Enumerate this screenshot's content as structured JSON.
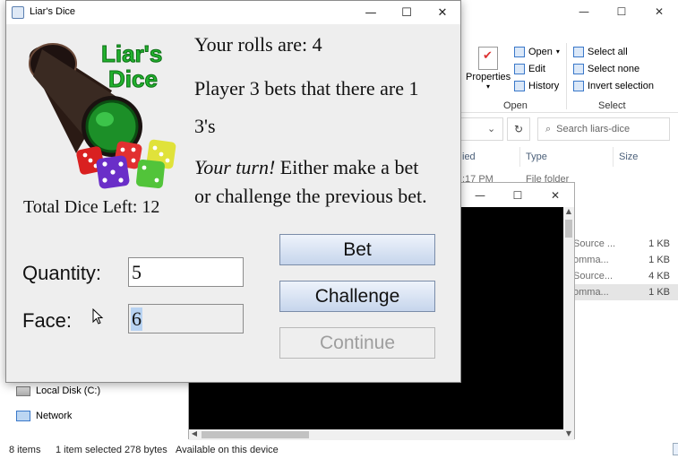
{
  "explorer": {
    "ribbon": {
      "properties_label": "Properties",
      "open_label": "Open",
      "edit_label": "Edit",
      "history_label": "History",
      "open_group": "Open",
      "select_all": "Select all",
      "select_none": "Select none",
      "invert_selection": "Invert selection",
      "select_group": "Select"
    },
    "search_placeholder": "Search liars-dice",
    "columns": {
      "date_fragment": "ied",
      "type": "Type",
      "size": "Size"
    },
    "folder_row": {
      "date_fragment": ":17 PM",
      "type": "File folder"
    },
    "files": [
      {
        "name": "Source ...",
        "size": "1 KB"
      },
      {
        "name": "omma...",
        "size": "1 KB"
      },
      {
        "name": "Source...",
        "size": "4 KB"
      },
      {
        "name": "omma...",
        "size": "1 KB"
      }
    ],
    "nav": {
      "local_disk": "Local Disk (C:)",
      "network": "Network"
    },
    "status": {
      "items": "8 items",
      "selected": "1 item selected  278 bytes",
      "availability": "Available on this device"
    }
  },
  "dice_window": {
    "title": "Liar's Dice",
    "logo_line1": "Liar's",
    "logo_line2": "Dice",
    "rolls_text": "Your rolls are: 4",
    "bet_line1": "Player 3 bets that there are 1",
    "bet_line2": "3's",
    "turn_emph": "Your turn!",
    "turn_rest": " Either make a bet",
    "turn_line2": "or challenge the previous bet.",
    "total_dice": "Total Dice Left: 12",
    "quantity_label": "Quantity:",
    "quantity_value": "5",
    "face_label": "Face:",
    "face_value": "6",
    "bet_button": "Bet",
    "challenge_button": "Challenge",
    "continue_button": "Continue"
  },
  "colors": {
    "logo_green": "#22b22e",
    "button_gradient_top": "#eef3fb",
    "button_gradient_bottom": "#c6d5ec",
    "disabled_text": "#9e9e9e"
  }
}
